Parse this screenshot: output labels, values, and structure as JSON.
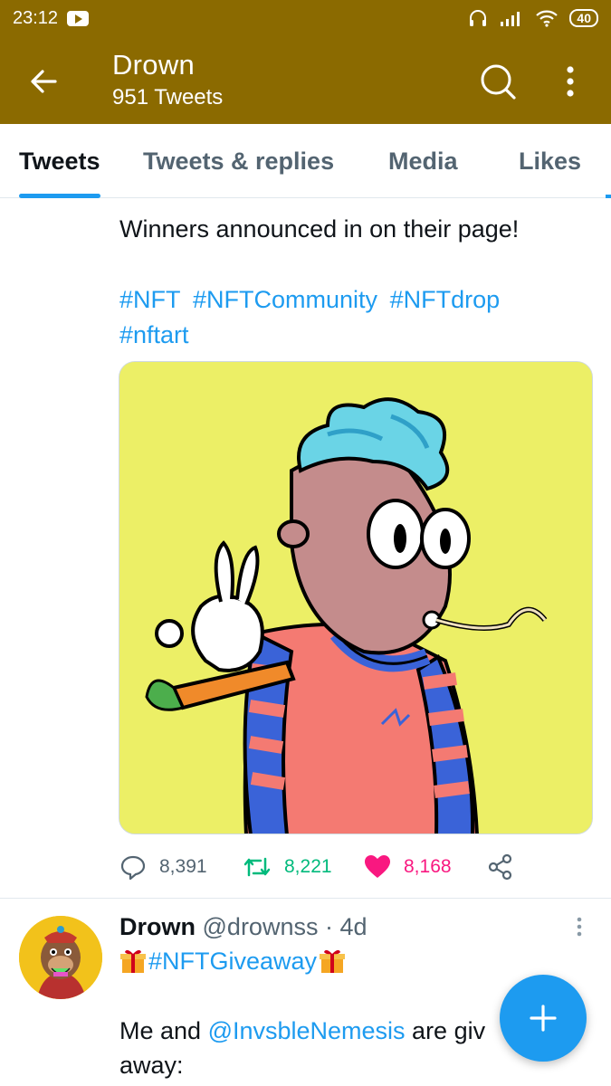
{
  "status_bar": {
    "time": "23:12",
    "battery": "40"
  },
  "header": {
    "name": "Drown",
    "tweet_count": "951 Tweets"
  },
  "tabs": [
    {
      "label": "Tweets",
      "active": true
    },
    {
      "label": "Tweets & replies",
      "active": false
    },
    {
      "label": "Media",
      "active": false
    },
    {
      "label": "Likes",
      "active": false
    }
  ],
  "tweet1": {
    "text": "Winners announced in on their page!",
    "hashtags": [
      "#NFT",
      "#NFTCommunity",
      "#NFTdrop",
      "#nftart"
    ],
    "replies": "8,391",
    "retweets": "8,221",
    "likes": "8,168"
  },
  "tweet2": {
    "name": "Drown",
    "handle": "@drownss",
    "separator": "·",
    "time": "4d",
    "hashtag": "#NFTGiveaway",
    "body_before": "Me and ",
    "mention": "@InvsbleNemesis",
    "body_after": " are giv",
    "body_line2": "away:"
  },
  "colors": {
    "header_bg": "#8b6a00",
    "accent": "#1d9bf0",
    "retweet": "#00ba7c",
    "like": "#f91880"
  }
}
